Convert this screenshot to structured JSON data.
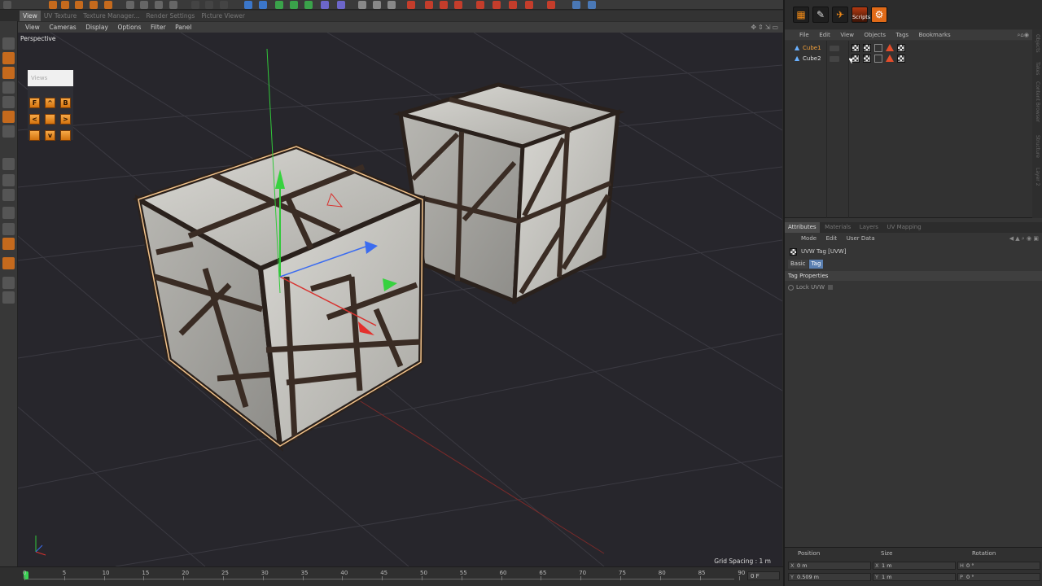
{
  "top_tabs": [
    "View",
    "UV Texture",
    "Texture Manager...",
    "Render Settings",
    "Picture Viewer"
  ],
  "viewport_menu": [
    "View",
    "Cameras",
    "Display",
    "Options",
    "Filter",
    "Panel"
  ],
  "viewport": {
    "label": "Perspective",
    "grid_spacing": "Grid Spacing : 1 m"
  },
  "views_widget": {
    "title": "Views",
    "buttons": [
      "F",
      "^",
      "B",
      "<",
      "",
      ">",
      "",
      "v",
      ""
    ]
  },
  "timeline": {
    "ticks": [
      "0",
      "5",
      "10",
      "15",
      "20",
      "25",
      "30",
      "35",
      "40",
      "45",
      "50",
      "55",
      "60",
      "65",
      "70",
      "75",
      "80",
      "85",
      "90"
    ],
    "frame": "0 F"
  },
  "right_panel": {
    "top_buttons": [
      "scripts"
    ],
    "scripts_label": "Scripts",
    "object_manager_menu": [
      "File",
      "Edit",
      "View",
      "Objects",
      "Tags",
      "Bookmarks"
    ],
    "objects": [
      {
        "name": "Cube1",
        "selected": true
      },
      {
        "name": "Cube2",
        "selected": false
      }
    ],
    "side_tabs": [
      "Objects",
      "Takes",
      "Content Browser",
      "Structure",
      "Layer 2"
    ],
    "attribute_tabs": [
      "Attributes",
      "Materials",
      "Layers",
      "UV Mapping"
    ],
    "attribute_menu": [
      "Mode",
      "Edit",
      "User Data"
    ],
    "attribute_title": "UVW Tag [UVW]",
    "sub_tabs": [
      "Basic",
      "Tag"
    ],
    "section": "Tag Properties",
    "lock_uvw": "Lock UVW",
    "coordinates": {
      "headers": [
        "Position",
        "Size",
        "Rotation"
      ],
      "position": [
        {
          "axis": "X",
          "value": "0 m"
        },
        {
          "axis": "Y",
          "value": "0.509 m"
        }
      ],
      "size": [
        {
          "axis": "X",
          "value": "1 m"
        },
        {
          "axis": "Y",
          "value": "1 m"
        }
      ],
      "rotation": [
        {
          "axis": "H",
          "value": "0 °"
        },
        {
          "axis": "P",
          "value": "0 °"
        }
      ]
    }
  },
  "colors": {
    "accent": "#f08a18",
    "viewport_bg": "#27262c",
    "selection": "#f4a13a"
  }
}
